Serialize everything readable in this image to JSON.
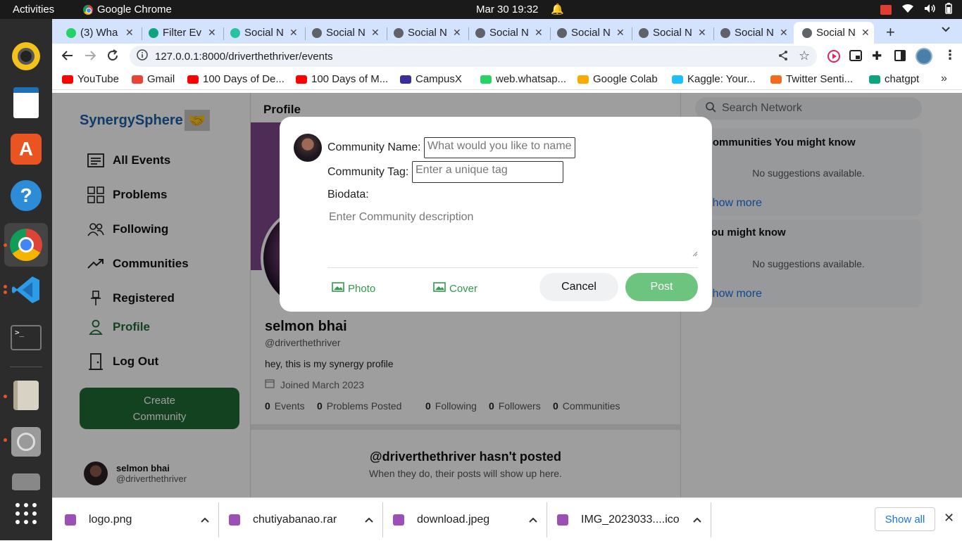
{
  "system": {
    "activities": "Activities",
    "app_name": "Google Chrome",
    "clock": "Mar 30  19:32"
  },
  "browser": {
    "tabs": [
      {
        "title": "(3) Wha",
        "icon": "whatsapp-icon",
        "color": "#25d366"
      },
      {
        "title": "Filter Ev",
        "icon": "openai-icon",
        "color": "#10a37f"
      },
      {
        "title": "Social N",
        "icon": "social-icon",
        "color": "#28c2a0"
      },
      {
        "title": "Social N",
        "icon": "globe-icon",
        "color": "#5f6368"
      },
      {
        "title": "Social N",
        "icon": "globe-icon",
        "color": "#5f6368"
      },
      {
        "title": "Social N",
        "icon": "globe-icon",
        "color": "#5f6368"
      },
      {
        "title": "Social N",
        "icon": "globe-icon",
        "color": "#5f6368"
      },
      {
        "title": "Social N",
        "icon": "globe-icon",
        "color": "#5f6368"
      },
      {
        "title": "Social N",
        "icon": "globe-icon",
        "color": "#5f6368"
      },
      {
        "title": "Social N",
        "icon": "globe-icon",
        "color": "#5f6368",
        "active": true
      }
    ],
    "url": "127.0.0.1:8000/driverthethriver/events",
    "bookmarks": [
      {
        "label": "YouTube",
        "color": "#ff0000"
      },
      {
        "label": "Gmail",
        "color": "#ea4335"
      },
      {
        "label": "100 Days of De...",
        "color": "#ff0000"
      },
      {
        "label": "100 Days of M...",
        "color": "#ff0000"
      },
      {
        "label": "CampusX",
        "color": "#3b2f9c"
      },
      {
        "label": "web.whatsap...",
        "color": "#25d366"
      },
      {
        "label": "Google Colab",
        "color": "#f9ab00"
      },
      {
        "label": "Kaggle: Your...",
        "color": "#20beff"
      },
      {
        "label": "Twitter Senti...",
        "color": "#f06d1f"
      },
      {
        "label": "chatgpt",
        "color": "#10a37f"
      }
    ]
  },
  "app": {
    "brand": "SynergySphere",
    "nav": [
      {
        "label": "All Events",
        "icon": "events-list-icon"
      },
      {
        "label": "Problems",
        "icon": "grid-icon"
      },
      {
        "label": "Following",
        "icon": "people-icon"
      },
      {
        "label": "Communities",
        "icon": "trending-icon"
      },
      {
        "label": "Registered",
        "icon": "pin-icon"
      },
      {
        "label": "Profile",
        "icon": "person-icon"
      },
      {
        "label": "Log Out",
        "icon": "door-icon"
      }
    ],
    "create_button": "Create Community",
    "footer_user": {
      "name": "selmon bhai",
      "handle": "@driverthethriver"
    },
    "profile": {
      "heading": "Profile",
      "name": "selmon bhai",
      "handle": "@driverthethriver",
      "bio": "hey, this is my synergy profile",
      "joined": "Joined March 2023",
      "stats": [
        {
          "count": "0",
          "label": "Events"
        },
        {
          "count": "0",
          "label": "Problems Posted"
        },
        {
          "count": "0",
          "label": "Following"
        },
        {
          "count": "0",
          "label": "Followers"
        },
        {
          "count": "0",
          "label": "Communities"
        }
      ],
      "empty_title": "@driverthethriver hasn't posted",
      "empty_sub": "When they do, their posts will show up here."
    },
    "right": {
      "search_placeholder": "Search Network",
      "card1_title": "Communities You might know",
      "card2_title": "You might know",
      "no_suggestions": "No suggestions available.",
      "show_more": "Show more"
    }
  },
  "modal": {
    "community_name_label": "Community Name:",
    "community_name_placeholder": "What would you like to name",
    "community_tag_label": "Community Tag:",
    "community_tag_placeholder": "Enter a unique tag",
    "biodata_label": "Biodata:",
    "description_placeholder": "Enter Community description",
    "photo_label": "Photo",
    "cover_label": "Cover",
    "cancel_label": "Cancel",
    "post_label": "Post"
  },
  "downloads": {
    "items": [
      "logo.png",
      "chutiyabanao.rar",
      "download.jpeg",
      "IMG_2023033....ico"
    ],
    "show_all": "Show all"
  },
  "colors": {
    "brand_blue": "#1c5fa8",
    "green_dark": "#1e6b34",
    "post_green": "#6cc47f",
    "link_blue": "#1a73e8"
  }
}
